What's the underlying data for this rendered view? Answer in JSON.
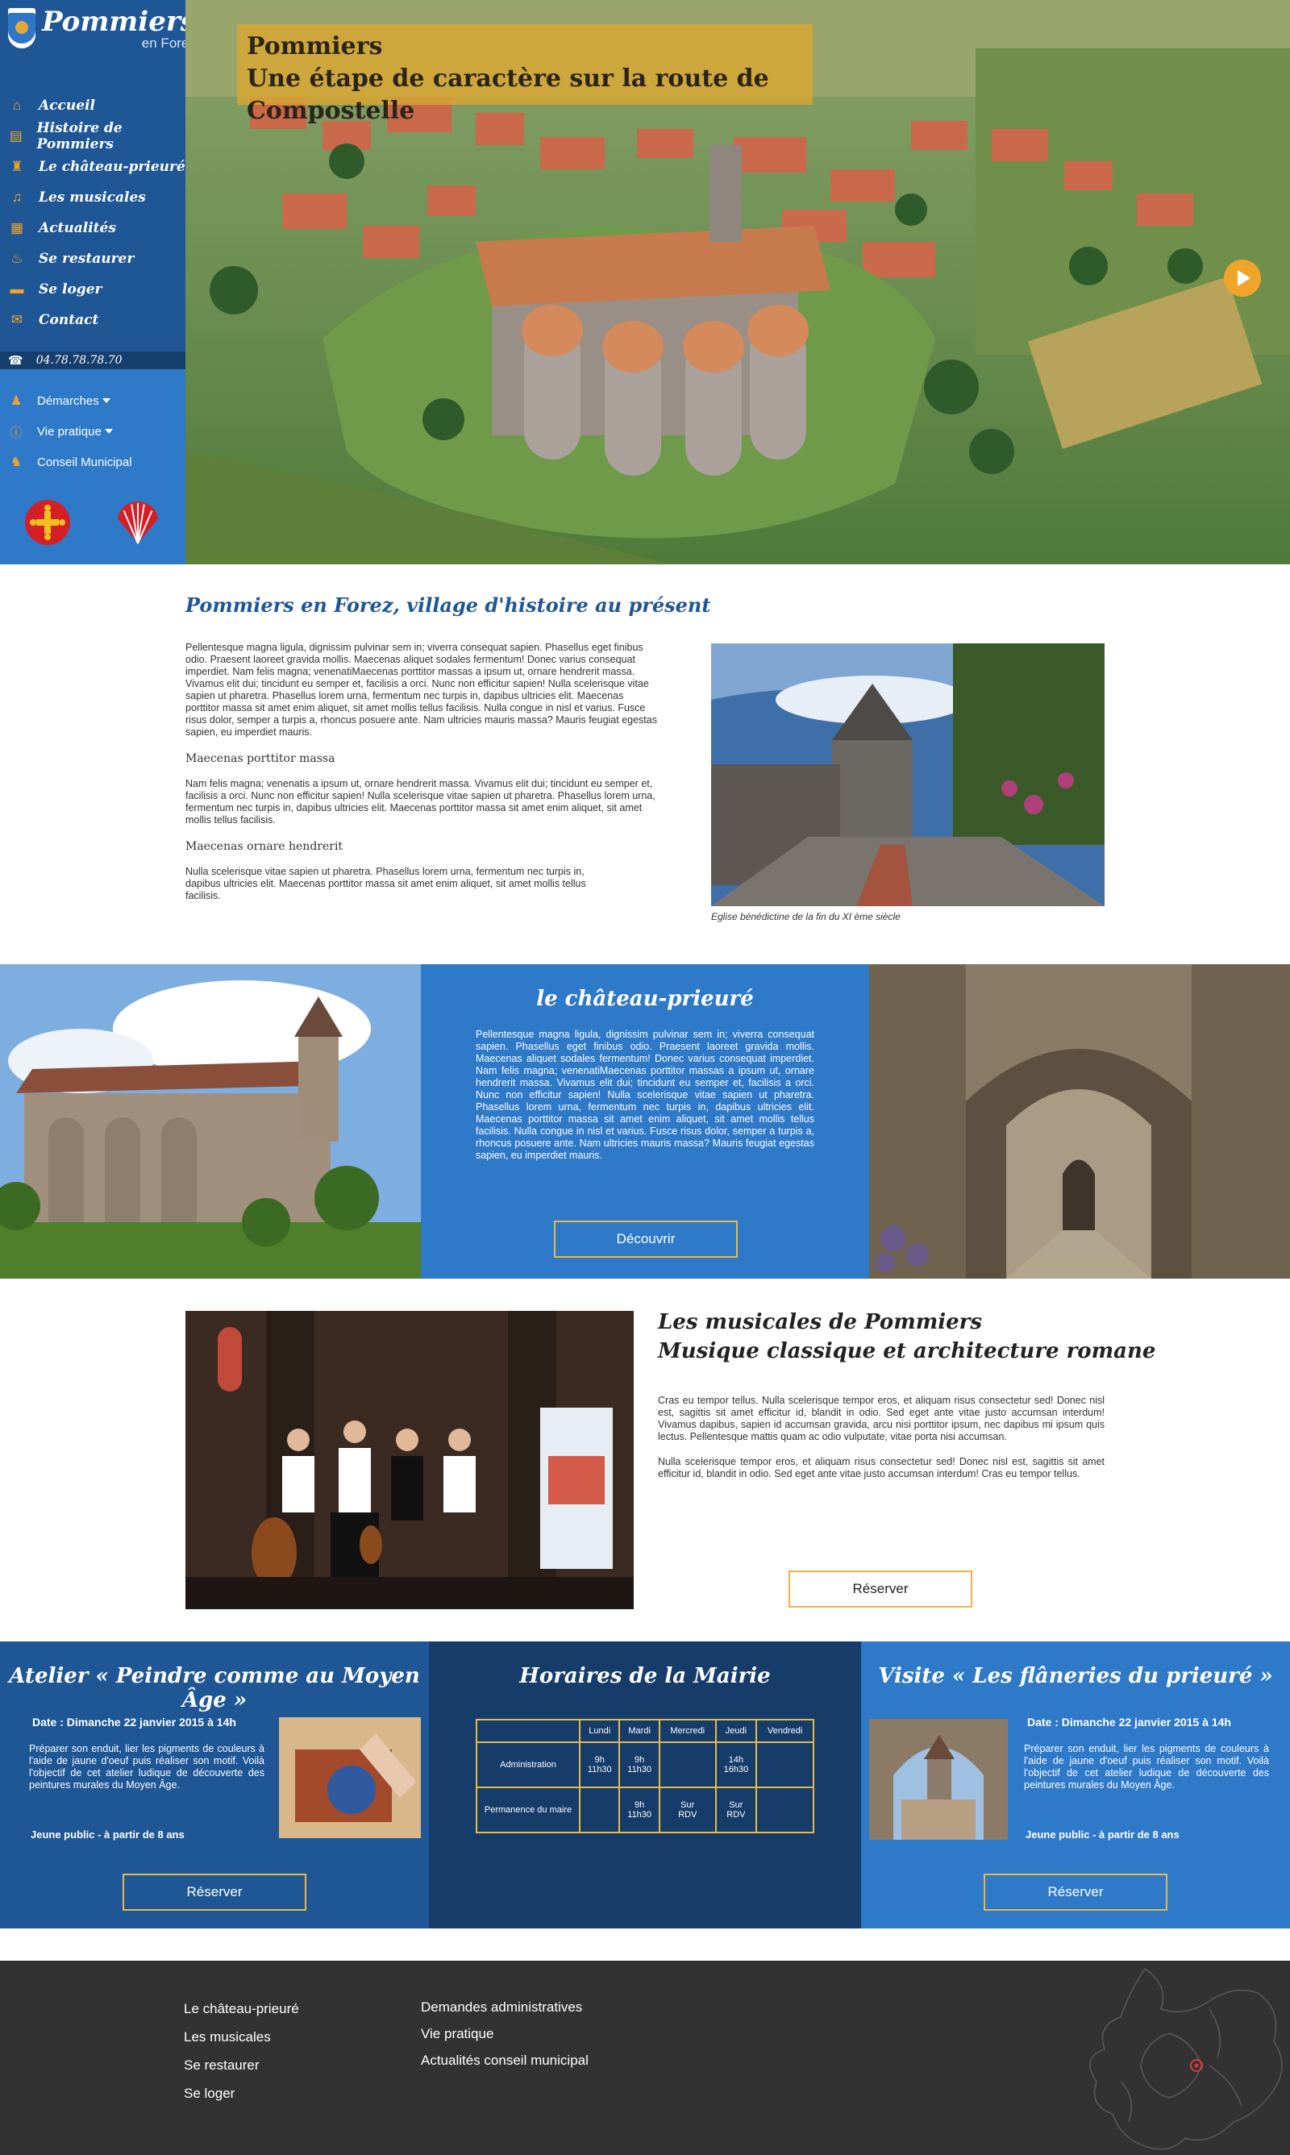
{
  "brand": {
    "name": "Pommiers",
    "sub": "en Forez"
  },
  "nav": [
    {
      "icon": "home-icon",
      "label": "Accueil"
    },
    {
      "icon": "book-icon",
      "label": "Histoire de Pommiers"
    },
    {
      "icon": "castle-icon",
      "label": "Le château-prieuré"
    },
    {
      "icon": "music-icon",
      "label": "Les musicales"
    },
    {
      "icon": "newspaper-icon",
      "label": "Actualités"
    },
    {
      "icon": "restaurant-icon",
      "label": "Se restaurer"
    },
    {
      "icon": "bed-icon",
      "label": "Se loger"
    },
    {
      "icon": "envelope-icon",
      "label": "Contact"
    }
  ],
  "phone": {
    "icon": "phone-icon",
    "number": "04.78.78.78.70"
  },
  "subnav": [
    {
      "icon": "person-icon",
      "label": "Démarches"
    },
    {
      "icon": "info-icon",
      "label": "Vie pratique"
    },
    {
      "icon": "council-icon",
      "label": "Conseil Municipal"
    }
  ],
  "emblems": [
    "occitan-cross-icon",
    "scallop-shell-icon"
  ],
  "colors": {
    "sidebar": "#1f5796",
    "accent": "#f0a52a",
    "blue": "#2f79c9",
    "navy": "#163c6a",
    "footer": "#323232"
  },
  "hero": {
    "title1": "Pommiers",
    "title2": "Une étape de caractère sur la route de Compostelle"
  },
  "intro": {
    "title": "Pommiers en Forez, village d'histoire au présent",
    "p1": "Pellentesque magna ligula, dignissim pulvinar sem in; viverra consequat sapien. Phasellus eget finibus odio. Praesent laoreet gravida mollis. Maecenas aliquet sodales fermentum! Donec varius consequat imperdiet. Nam felis magna; venenatiMaecenas porttitor massas a ipsum ut, ornare hendrerit massa. Vivamus elit dui; tincidunt eu semper et, facilisis a orci. Nunc non efficitur sapien! Nulla scelerisque vitae sapien ut pharetra. Phasellus lorem urna, fermentum nec turpis in, dapibus ultricies elit. Maecenas porttitor massa sit amet enim aliquet, sit amet mollis tellus facilisis. Nulla congue in nisl et varius. Fusce risus dolor, semper a turpis a, rhoncus posuere ante. Nam ultricies mauris massa? Mauris feugiat egestas sapien, eu imperdiet mauris.",
    "h2": "Maecenas porttitor massa",
    "p2": "Nam felis magna; venenatis a ipsum ut, ornare hendrerit massa. Vivamus elit dui; tincidunt eu semper et, facilisis a orci. Nunc non efficitur sapien! Nulla scelerisque vitae sapien ut pharetra. Phasellus lorem urna, fermentum nec turpis in, dapibus ultricies elit. Maecenas porttitor massa sit amet enim aliquet, sit amet mollis tellus facilisis.",
    "h3": "Maecenas ornare hendrerit",
    "p3": "Nulla scelerisque vitae sapien ut pharetra. Phasellus lorem urna, fermentum nec turpis in, dapibus ultricies elit. Maecenas porttitor massa sit amet enim aliquet, sit amet mollis tellus facilisis.",
    "caption": "Eglise bénédictine de la fin du XI ème siècle"
  },
  "chateau": {
    "title": "le château-prieuré",
    "text": "Pellentesque magna ligula, dignissim pulvinar sem in; viverra consequat sapien. Phasellus eget finibus odio. Praesent laoreet gravida mollis. Maecenas aliquet sodales fermentum! Donec varius consequat imperdiet. Nam felis magna; venenatiMaecenas porttitor massas a ipsum ut, ornare hendrerit massa. Vivamus elit dui; tincidunt eu semper et, facilisis a orci. Nunc non efficitur sapien! Nulla scelerisque vitae sapien ut pharetra. Phasellus lorem urna, fermentum nec turpis in, dapibus ultricies elit. Maecenas porttitor massa sit amet enim aliquet, sit amet mollis tellus facilisis. Nulla congue in nisl et varius. Fusce risus dolor, semper a turpis a, rhoncus posuere ante. Nam ultricies mauris massa? Mauris feugiat egestas sapien, eu imperdiet mauris.",
    "button": "Découvrir"
  },
  "musicales": {
    "title1": "Les musicales de Pommiers",
    "title2": "Musique  classique et architecture romane",
    "p1": "Cras eu tempor tellus. Nulla scelerisque tempor eros, et aliquam risus consectetur sed! Donec nisl est, sagittis sit amet efficitur id, blandit in odio. Sed eget ante vitae justo accumsan interdum! Vivamus dapibus, sapien id accumsan gravida, arcu nisi porttitor ipsum, nec dapibus mi ipsum quis lectus. Pellentesque mattis quam ac odio vulputate, vitae porta nisi accumsan.",
    "p2": "Nulla scelerisque tempor eros, et aliquam risus consectetur sed! Donec nisl est, sagittis sit amet efficitur id, blandit in odio. Sed eget ante vitae justo accumsan interdum! Cras eu tempor tellus.",
    "button": "Réserver"
  },
  "atelier": {
    "title": "Atelier « Peindre comme au Moyen Âge »",
    "date": "Date : Dimanche 22 janvier 2015 à 14h",
    "text": "Préparer son enduit, lier les pigments de couleurs à l'aide de jaune d'oeuf puis réaliser son motif. Voilà l'objectif de cet atelier ludique de découverte des peintures murales du Moyen Âge.",
    "public": "Jeune public - à partir de 8 ans",
    "button": "Réserver"
  },
  "horaires": {
    "title": "Horaires de la Mairie",
    "days": [
      "Lundi",
      "Mardi",
      "Mercredi",
      "Jeudi",
      "Vendredi"
    ],
    "rows": [
      {
        "label": "Administration",
        "cells": [
          "9h\n11h30",
          "9h\n11h30",
          "",
          "14h\n16h30",
          ""
        ]
      },
      {
        "label": "Permanence du maire",
        "cells": [
          "",
          "9h\n11h30",
          "Sur\nRDV",
          "Sur\nRDV",
          ""
        ]
      }
    ]
  },
  "visite": {
    "title": "Visite « Les flâneries du prieuré »",
    "date": "Date : Dimanche 22 janvier 2015 à 14h",
    "text": "Préparer son enduit, lier les pigments de couleurs à l'aide de jaune d'oeuf puis réaliser son motif. Voilà l'objectif de cet atelier ludique de découverte des peintures murales du Moyen Âge.",
    "public": "Jeune public - à partir de 8 ans",
    "button": "Réserver"
  },
  "footer": {
    "col1": [
      "Le château-prieuré",
      "Les musicales",
      "Se restaurer",
      "Se loger"
    ],
    "col2": [
      "Demandes administratives",
      "Vie pratique",
      "Actualités conseil municipal"
    ]
  }
}
